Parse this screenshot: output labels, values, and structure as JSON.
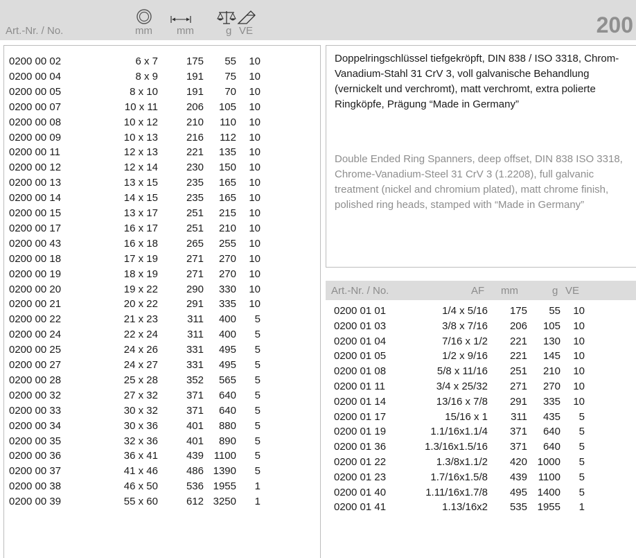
{
  "header": {
    "art_label": "Art.-Nr. / No.",
    "col_size_unit": "mm",
    "col_length_unit": "mm",
    "col_weight_unit": "g",
    "col_ve": "VE",
    "page_number": "200",
    "icons": [
      "ring-spanner-icon",
      "length-arrow-icon",
      "scale-weight-icon",
      "eraser-packing-icon"
    ]
  },
  "left_table": {
    "rows": [
      [
        "0200 00 02",
        "6 x 7",
        "175",
        "55",
        "10"
      ],
      [
        "0200 00 04",
        "8 x 9",
        "191",
        "75",
        "10"
      ],
      [
        "0200 00 05",
        "8 x 10",
        "191",
        "70",
        "10"
      ],
      [
        "0200 00 07",
        "10 x 11",
        "206",
        "105",
        "10"
      ],
      [
        "0200 00 08",
        "10 x 12",
        "210",
        "110",
        "10"
      ],
      [
        "0200 00 09",
        "10 x 13",
        "216",
        "112",
        "10"
      ],
      [
        "0200 00 11",
        "12 x 13",
        "221",
        "135",
        "10"
      ],
      [
        "0200 00 12",
        "12 x 14",
        "230",
        "150",
        "10"
      ],
      [
        "0200 00 13",
        "13 x 15",
        "235",
        "165",
        "10"
      ],
      [
        "0200 00 14",
        "14 x 15",
        "235",
        "165",
        "10"
      ],
      [
        "0200 00 15",
        "13 x 17",
        "251",
        "215",
        "10"
      ],
      [
        "0200 00 17",
        "16 x 17",
        "251",
        "210",
        "10"
      ],
      [
        "0200 00 43",
        "16 x 18",
        "265",
        "255",
        "10"
      ],
      [
        "0200 00 18",
        "17 x 19",
        "271",
        "270",
        "10"
      ],
      [
        "0200 00 19",
        "18 x 19",
        "271",
        "270",
        "10"
      ],
      [
        "0200 00 20",
        "19 x 22",
        "290",
        "330",
        "10"
      ],
      [
        "0200 00 21",
        "20 x 22",
        "291",
        "335",
        "10"
      ],
      [
        "0200 00 22",
        "21 x 23",
        "311",
        "400",
        "5"
      ],
      [
        "0200 00 24",
        "22 x 24",
        "311",
        "400",
        "5"
      ],
      [
        "0200 00 25",
        "24 x 26",
        "331",
        "495",
        "5"
      ],
      [
        "0200 00 27",
        "24 x 27",
        "331",
        "495",
        "5"
      ],
      [
        "0200 00 28",
        "25 x 28",
        "352",
        "565",
        "5"
      ],
      [
        "0200 00 32",
        "27 x 32",
        "371",
        "640",
        "5"
      ],
      [
        "0200 00 33",
        "30 x 32",
        "371",
        "640",
        "5"
      ],
      [
        "0200 00 34",
        "30 x 36",
        "401",
        "880",
        "5"
      ],
      [
        "0200 00 35",
        "32 x 36",
        "401",
        "890",
        "5"
      ],
      [
        "0200 00 36",
        "36 x 41",
        "439",
        "1100",
        "5"
      ],
      [
        "0200 00 37",
        "41 x 46",
        "486",
        "1390",
        "5"
      ],
      [
        "0200 00 38",
        "46 x 50",
        "536",
        "1955",
        "1"
      ],
      [
        "0200 00 39",
        "55 x 60",
        "612",
        "3250",
        "1"
      ]
    ]
  },
  "description": {
    "german": "Doppelringschlüssel tiefgekröpft, DIN 838 / ISO 3318, Chrom-Vanadium-Stahl 31 CrV 3, voll galvanische Behandlung (vernickelt und verchromt), matt verchromt, extra polierte Ringköpfe, Prägung “Made in Germany”",
    "english": "Double Ended Ring Spanners, deep offset, DIN 838 ISO 3318, Chrome-Vanadium-Steel 31 CrV 3 (1.2208), full galvanic treatment (nickel and chromium plated), matt chrome finish, polished ring heads, stamped with “Made in Germany”"
  },
  "right_table": {
    "headers": {
      "art": "Art.-Nr. / No.",
      "af": "AF",
      "mm": "mm",
      "g": "g",
      "ve": "VE"
    },
    "rows": [
      [
        "0200 01 01",
        "1/4 x 5/16",
        "175",
        "55",
        "10"
      ],
      [
        "0200 01 03",
        "3/8 x 7/16",
        "206",
        "105",
        "10"
      ],
      [
        "0200 01 04",
        "7/16 x 1/2",
        "221",
        "130",
        "10"
      ],
      [
        "0200 01 05",
        "1/2 x 9/16",
        "221",
        "145",
        "10"
      ],
      [
        "0200 01 08",
        "5/8 x 11/16",
        "251",
        "210",
        "10"
      ],
      [
        "0200 01 11",
        "3/4 x 25/32",
        "271",
        "270",
        "10"
      ],
      [
        "0200 01 14",
        "13/16 x 7/8",
        "291",
        "335",
        "10"
      ],
      [
        "0200 01 17",
        "15/16 x 1",
        "311",
        "435",
        "5"
      ],
      [
        "0200 01 19",
        "1.1/16x1.1/4",
        "371",
        "640",
        "5"
      ],
      [
        "0200 01 36",
        "1.3/16x1.5/16",
        "371",
        "640",
        "5"
      ],
      [
        "0200 01 22",
        "1.3/8x1.1/2",
        "420",
        "1000",
        "5"
      ],
      [
        "0200 01 23",
        "1.7/16x1.5/8",
        "439",
        "1100",
        "5"
      ],
      [
        "0200 01 40",
        "1.11/16x1.7/8",
        "495",
        "1400",
        "5"
      ],
      [
        "0200 01 41",
        "1.13/16x2",
        "535",
        "1955",
        "1"
      ]
    ]
  }
}
